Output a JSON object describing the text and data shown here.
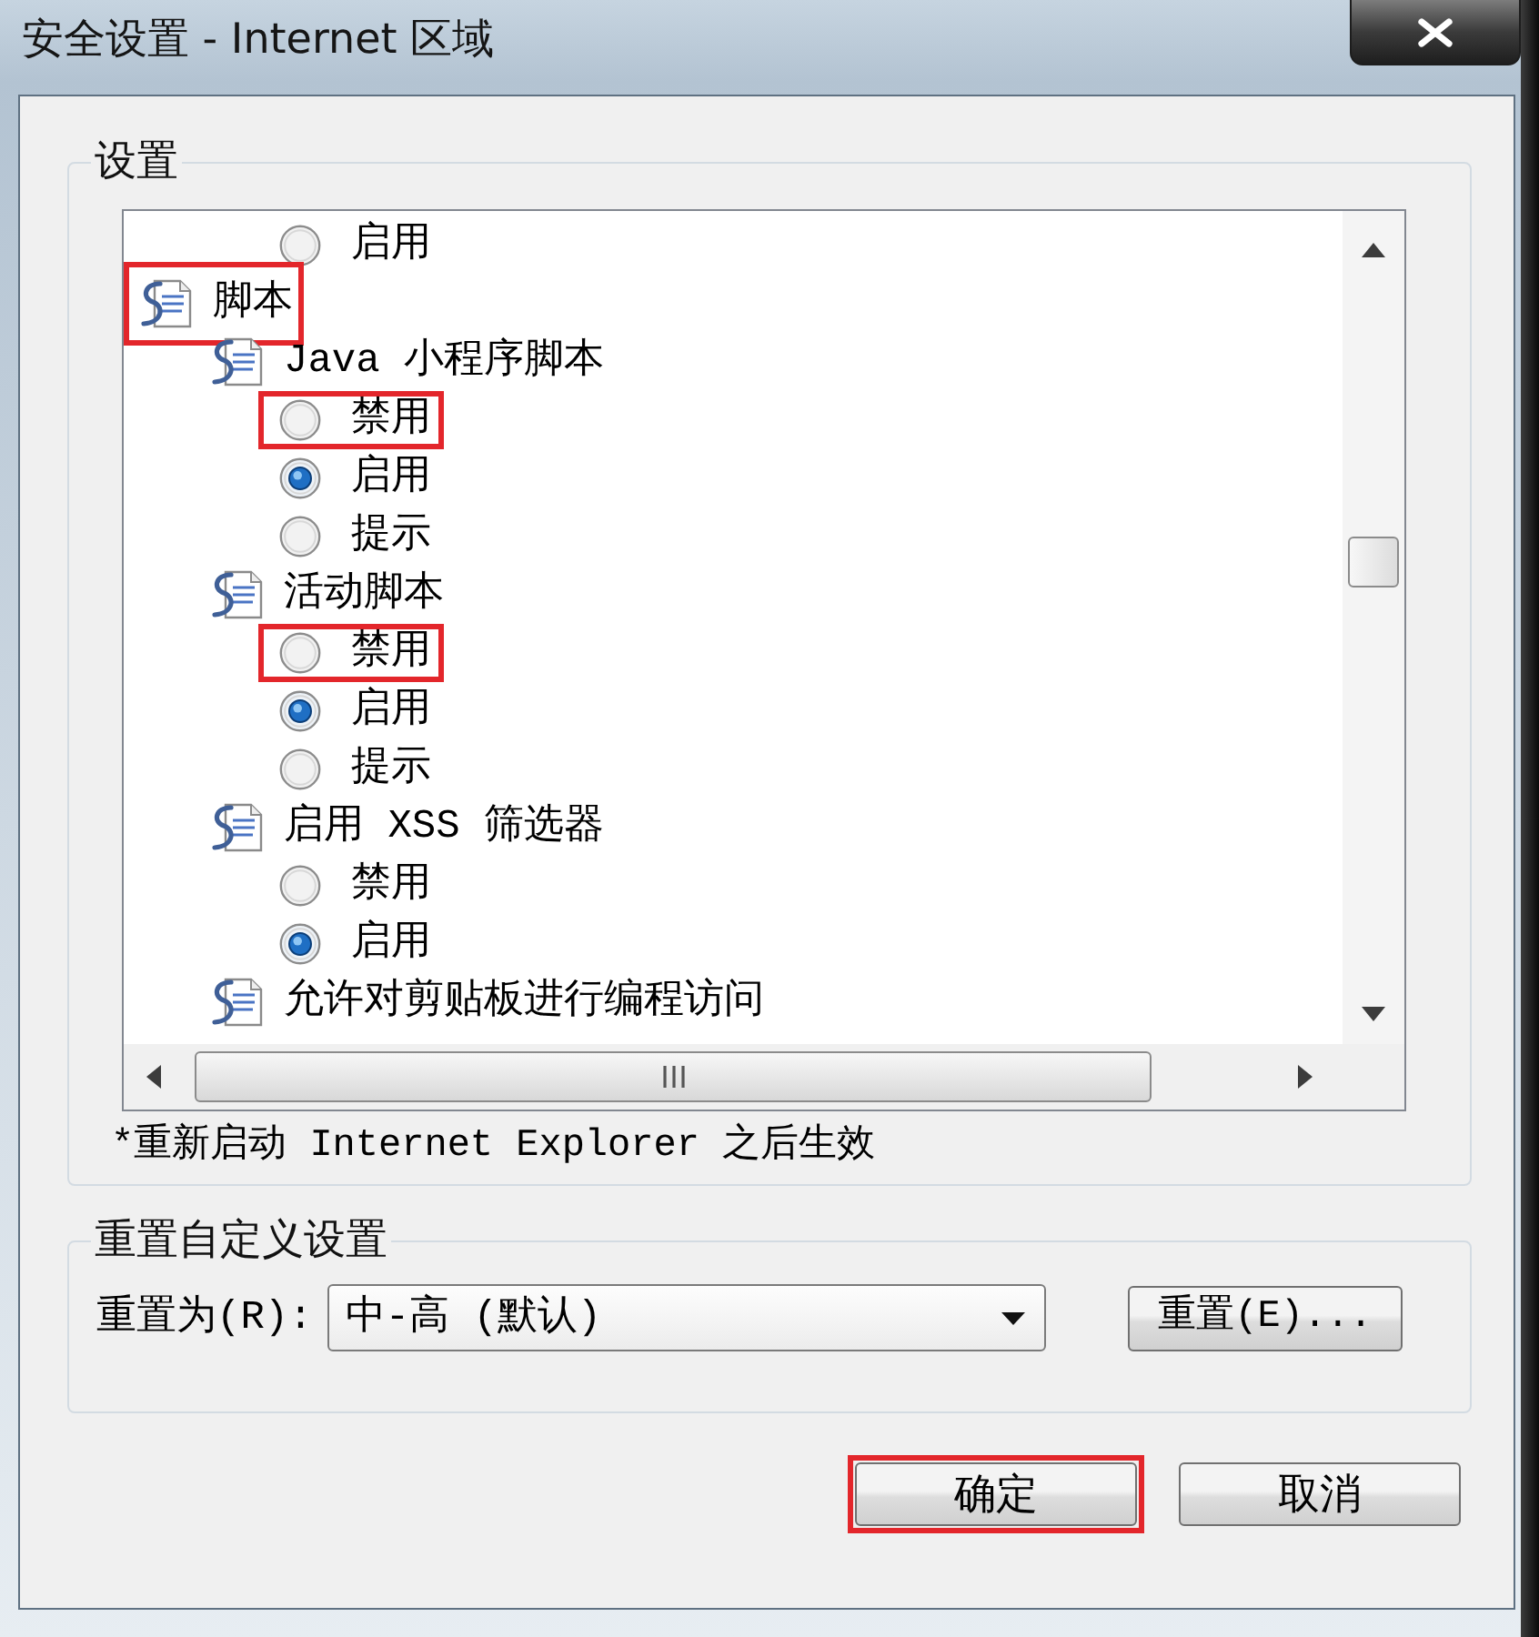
{
  "window": {
    "title": "安全设置 - Internet 区域"
  },
  "settings": {
    "label": "设置",
    "tree": [
      {
        "kind": "category",
        "children": [
          {
            "kind": "category",
            "children": [
              {
                "kind": "radio",
                "label": "启用",
                "selected": false,
                "highlighted": false
              }
            ]
          }
        ]
      },
      {
        "kind": "category",
        "label": "脚本",
        "highlighted": true,
        "children": [
          {
            "kind": "category",
            "label": "Java 小程序脚本",
            "highlighted": false,
            "children": [
              {
                "kind": "radio",
                "label": "禁用",
                "selected": false,
                "highlighted": true
              },
              {
                "kind": "radio",
                "label": "启用",
                "selected": true,
                "highlighted": false
              },
              {
                "kind": "radio",
                "label": "提示",
                "selected": false,
                "highlighted": false
              }
            ]
          },
          {
            "kind": "category",
            "label": "活动脚本",
            "highlighted": false,
            "children": [
              {
                "kind": "radio",
                "label": "禁用",
                "selected": false,
                "highlighted": true
              },
              {
                "kind": "radio",
                "label": "启用",
                "selected": true,
                "highlighted": false
              },
              {
                "kind": "radio",
                "label": "提示",
                "selected": false,
                "highlighted": false
              }
            ]
          },
          {
            "kind": "category",
            "label": "启用 XSS 筛选器",
            "highlighted": false,
            "children": [
              {
                "kind": "radio",
                "label": "禁用",
                "selected": false,
                "highlighted": false
              },
              {
                "kind": "radio",
                "label": "启用",
                "selected": true,
                "highlighted": false
              }
            ]
          },
          {
            "kind": "category",
            "label": "允许对剪贴板进行编程访问",
            "highlighted": false
          }
        ]
      }
    ],
    "note": "*重新启动 Internet Explorer 之后生效"
  },
  "reset": {
    "label": "重置自定义设置",
    "reset_to_label": "重置为(R):",
    "reset_to_value": "中-高 (默认)",
    "button": "重置(E)..."
  },
  "buttons": [
    {
      "label": "确定",
      "highlighted": true
    },
    {
      "label": "取消",
      "highlighted": false
    }
  ]
}
